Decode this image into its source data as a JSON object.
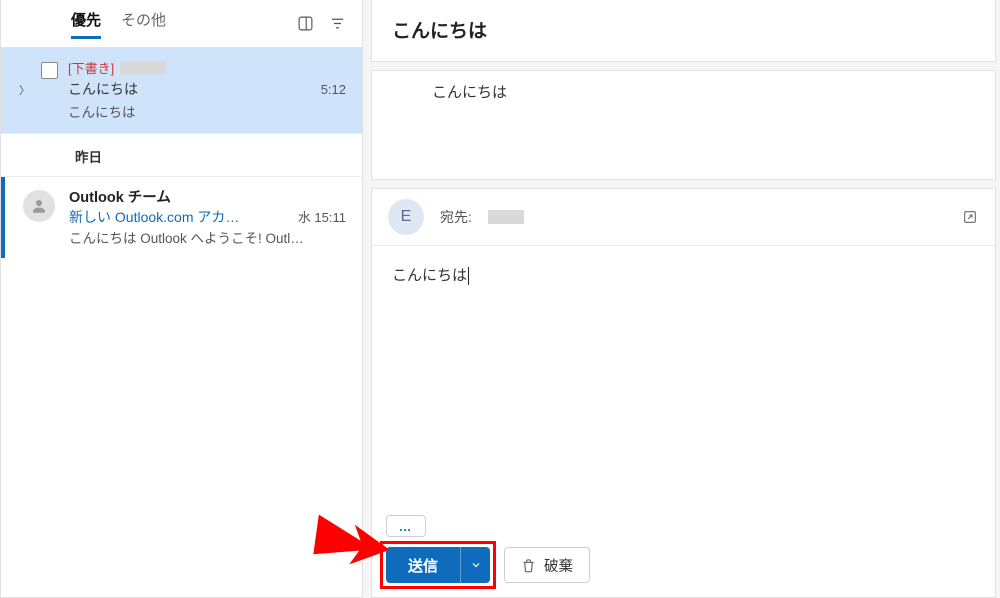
{
  "tabs": {
    "focused": "優先",
    "other": "その他"
  },
  "list": {
    "drafts": {
      "tag": "[下書き]",
      "subject": "こんにちは",
      "preview": "こんにちは",
      "time": "5:12"
    },
    "section_yesterday": "昨日",
    "outlook": {
      "sender": "Outlook チーム",
      "subject": "新しい Outlook.com アカ…",
      "time": "水 15:11",
      "preview": "こんにちは Outlook へようこそ! Outl…"
    }
  },
  "reading": {
    "title": "こんにちは",
    "body": "こんにちは"
  },
  "compose": {
    "avatar_initial": "E",
    "to_label": "宛先:",
    "body": "こんにちは",
    "more": "…",
    "send": "送信",
    "discard": "破棄"
  }
}
